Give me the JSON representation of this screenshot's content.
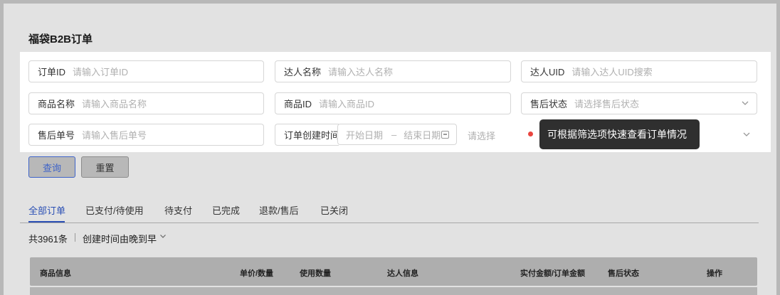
{
  "page": {
    "title": "福袋B2B订单"
  },
  "filters": [
    {
      "label": "订单ID",
      "placeholder": "请输入订单ID"
    },
    {
      "label": "达人名称",
      "placeholder": "请输入达人名称"
    },
    {
      "label": "达人UID",
      "placeholder": "请输入达人UID搜索"
    },
    {
      "label": "商品名称",
      "placeholder": "请输入商品名称"
    },
    {
      "label": "商品ID",
      "placeholder": "请输入商品ID"
    },
    {
      "label": "售后状态",
      "placeholder": "请选择售后状态"
    },
    {
      "label": "售后单号",
      "placeholder": "请输入售后单号"
    },
    {
      "label": "订单创建时间",
      "start_placeholder": "开始日期",
      "range_separator": "–",
      "end_placeholder": "结束日期"
    }
  ],
  "extra_select": {
    "placeholder": "请选择"
  },
  "tooltip": {
    "text": "可根据筛选项快速查看订单情况"
  },
  "buttons": {
    "query": "查询",
    "reset": "重置"
  },
  "tabs": [
    "全部订单",
    "已支付/待使用",
    "待支付",
    "已完成",
    "退款/售后",
    "已关闭"
  ],
  "active_tab": "全部订单",
  "summary": {
    "count_text": "共3961条",
    "sort_text": "创建时间由晚到早"
  },
  "table": {
    "columns": [
      "商品信息",
      "单价/数量",
      "使用数量",
      "达人信息",
      "实付金额/订单金额",
      "售后状态",
      "操作"
    ]
  },
  "colors": {
    "accent": "#2a4fb4",
    "tooltip_bg": "#2f2f2f",
    "red_dot": "#e9453f"
  },
  "icons": [
    "chevron-down-icon",
    "calendar-icon",
    "red-dot-indicator"
  ]
}
